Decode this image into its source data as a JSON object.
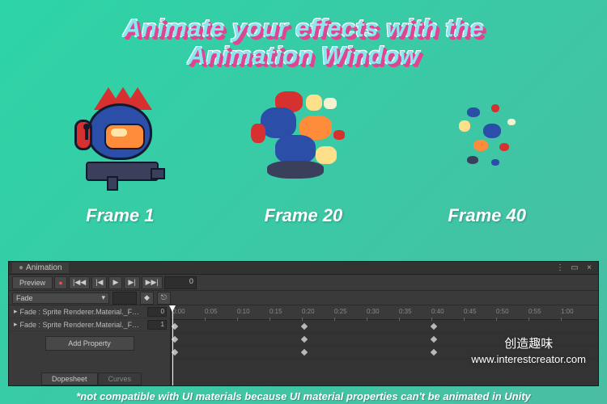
{
  "hero": {
    "line1": "Animate your effects with the",
    "line2": "Animation Window"
  },
  "frames": {
    "items": [
      {
        "label": "Frame 1"
      },
      {
        "label": "Frame 20"
      },
      {
        "label": "Frame 40"
      }
    ]
  },
  "animation_window": {
    "tab_title": "Animation",
    "preview_btn": "Preview",
    "record_icon": "●",
    "first_icon": "|◀◀",
    "prev_icon": "|◀",
    "play_icon": "▶",
    "next_icon": "▶|",
    "last_icon": "▶▶|",
    "frame_field": "0",
    "clip_name": "Fade",
    "clip_chevron": "▾",
    "samples_field": "",
    "diamond_icon": "◆",
    "event_icon": "⎋",
    "properties": [
      {
        "exp": "▸",
        "name": "Fade : Sprite Renderer.Material._F…",
        "value": "0"
      },
      {
        "exp": "▸",
        "name": "Fade : Sprite Renderer.Material._F…",
        "value": "1"
      }
    ],
    "add_property": "Add Property",
    "bottom_tabs": {
      "dopesheet": "Dopesheet",
      "curves": "Curves"
    },
    "ruler_ticks": [
      "0:00",
      "0:05",
      "0:10",
      "0:15",
      "0:20",
      "0:25",
      "0:30",
      "0:35",
      "0:40",
      "0:45",
      "0:50",
      "0:55",
      "1:00"
    ],
    "window_controls": {
      "menu": "⋮",
      "max": "▭",
      "close": "×"
    }
  },
  "watermark": {
    "cn": "创造趣味",
    "url": "www.interestcreator.com"
  },
  "footnote": "*not compatible with UI materials because UI material properties can't be animated in Unity"
}
